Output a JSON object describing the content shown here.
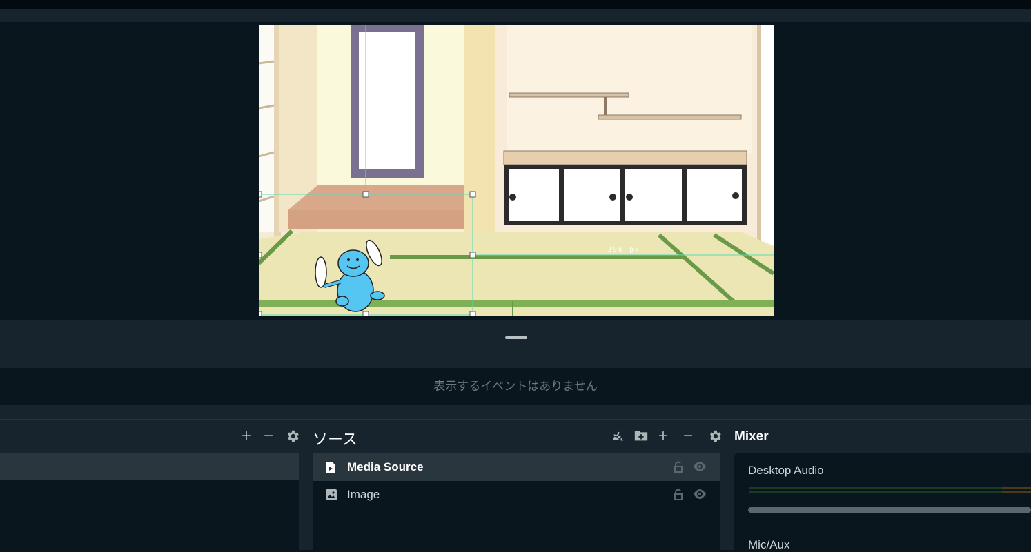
{
  "editor": {
    "distance_label": "396 px"
  },
  "events": {
    "empty_message": "表示するイベントはありません"
  },
  "scenes": {
    "toolbar": {
      "add": "+",
      "remove": "−"
    }
  },
  "sources": {
    "title": "ソース",
    "toolbar": {
      "add": "+",
      "remove": "−"
    },
    "items": [
      {
        "label": "Media Source",
        "icon": "media-file-icon",
        "selected": true
      },
      {
        "label": "Image",
        "icon": "image-icon",
        "selected": false
      }
    ]
  },
  "mixer": {
    "title": "Mixer",
    "channels": [
      {
        "name": "Desktop Audio"
      },
      {
        "name": "Mic/Aux"
      }
    ]
  },
  "colors": {
    "background": "#09161d",
    "panel": "#17242d",
    "selected_row": "#2a363e",
    "selection_guide": "#5ed9b4"
  }
}
